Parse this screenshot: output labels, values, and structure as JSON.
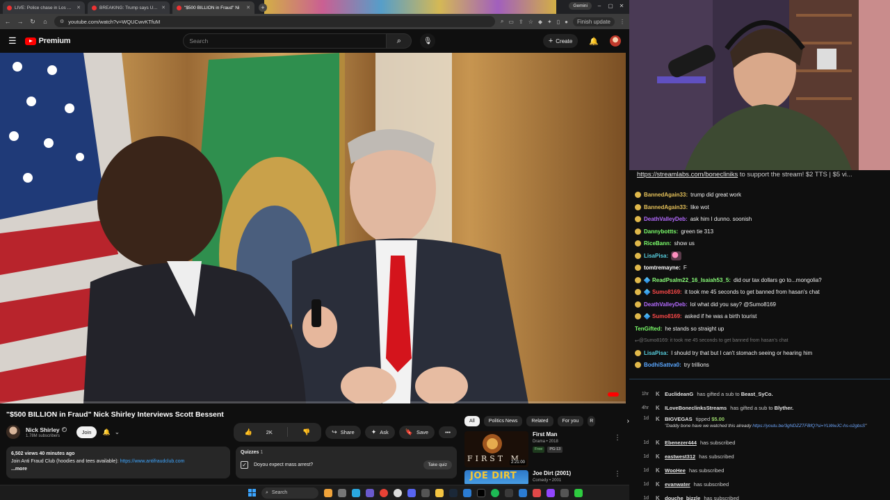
{
  "browser": {
    "tabs": [
      {
        "title": "LIVE: Police chase in Los Angeles",
        "active": false
      },
      {
        "title": "BREAKING: Trump says US wo",
        "active": false
      },
      {
        "title": "\"$500 BILLION in Fraud\" Ni",
        "active": true
      }
    ],
    "gemini_label": "Gemini",
    "url": "youtube.com/watch?v=WQUCwvKTfuM",
    "update_label": "Finish update"
  },
  "youtube": {
    "logo_text": "Premium",
    "search_placeholder": "Search",
    "create_label": "Create",
    "video": {
      "title": "\"$500 BILLION in Fraud\" Nick Shirley Interviews Scott Bessent",
      "channel": "Nick Shirley",
      "subscribers": "1.78M subscribers",
      "join_label": "Join",
      "likes": "2K",
      "share_label": "Share",
      "ask_label": "Ask",
      "save_label": "Save",
      "stats": "6,502 views  40 minutes ago",
      "description_text": "Join Anti Fraud Club (hoodies and tees available): ",
      "description_link": "https://www.antifraudclub.com",
      "more_label": "...more",
      "quiz_title": "Quizzes",
      "quiz_count": "1",
      "quiz_question": "Doyou expect mass arrest?",
      "quiz_button": "Take quiz"
    },
    "chips": [
      "All",
      "Politics News",
      "Related",
      "For you",
      "R"
    ],
    "related": [
      {
        "title": "First Man",
        "meta": "Drama • 2018",
        "badges": [
          "Free",
          "PG-13"
        ],
        "thumb_text": "FIRST M",
        "duration": "2:21:00"
      },
      {
        "title": "Joe Dirt (2001)",
        "meta": "Comedy • 2001",
        "thumb_text": "JOE DIRT"
      }
    ]
  },
  "taskbar": {
    "search_label": "Search"
  },
  "stream": {
    "alert_link": "https://streamlabs.com/bonecliniks",
    "alert_text": " to support the stream! $2 TTS | $5 vi...",
    "chat": [
      {
        "name": "BannedAgain33:",
        "msg": "trump did great work",
        "color": "#e6c25a",
        "icon": "emo"
      },
      {
        "name": "BannedAgain33:",
        "msg": "like wot",
        "color": "#e6c25a",
        "icon": "emo"
      },
      {
        "name": "DeathValleyDeb:",
        "msg": "ask him I dunno. soonish",
        "color": "#b46bff",
        "icon": "emo"
      },
      {
        "name": "Dannybottts:",
        "msg": "green tie 313",
        "color": "#7cff6b",
        "icon": "emo"
      },
      {
        "name": "RiceBann:",
        "msg": "show us",
        "color": "#7cff6b",
        "icon": "emo"
      },
      {
        "name": "LisaPisa:",
        "msg": "",
        "color": "#58d0e0",
        "icon": "emo",
        "sticker": true
      },
      {
        "name": "tomtremayne:",
        "msg": "F",
        "color": "#ffffff",
        "icon": "emo"
      },
      {
        "name": "ReadPsalm22_16_Isaiah53_5:",
        "msg": "did our tax dollars go to...mongolia?",
        "color": "#8aff7a",
        "icon": "gem"
      },
      {
        "name": "Sumo8169:",
        "msg": "it took me 45 seconds to get banned from hasan's chat",
        "color": "#ff4a4a",
        "icon": "gem"
      },
      {
        "name": "DeathValleyDeb:",
        "msg": "lol what did you say? @Sumo8169",
        "color": "#b46bff",
        "icon": "emo"
      },
      {
        "name": "Sumo8169:",
        "msg": "asked if he was a birth tourist",
        "color": "#ff4a4a",
        "icon": "gem"
      },
      {
        "name": "TenGifted:",
        "msg": "he stands so straight up",
        "color": "#7cff6b",
        "icon": "none"
      },
      {
        "name": "",
        "msg": "@Sumo8169: it took me 45 seconds to get banned from hasan's chat",
        "color": "#777777",
        "icon": "reply",
        "dim": true
      },
      {
        "name": "LisaPisa:",
        "msg": "I should try that but I can't stomach seeing or hearing him",
        "color": "#58d0e0",
        "icon": "emo"
      },
      {
        "name": "BodhiSattva0:",
        "msg": "try trillions",
        "color": "#5aa7ff",
        "icon": "emo"
      }
    ],
    "feed": [
      {
        "time": "1hr",
        "user": "EuclideanG",
        "text": " has gifted a sub to ",
        "target": "Beast_SyCo."
      },
      {
        "time": "4hr",
        "user": "ILoveBoneclinksStreams",
        "text": " has gifted a sub to ",
        "target": "Blyther."
      },
      {
        "time": "1d",
        "user": "BIGVEGAS",
        "text": " tipped ",
        "amount": "$5.00",
        "message": "\"Daddy bone have we watched this already ",
        "message_link": "https://youtu.be/3gNDZZTFBfQ?si=YLWwJC-hs-o2gbsS",
        "message_end": "\""
      },
      {
        "time": "1d",
        "user": "Ebenezer444",
        "text": " has subscribed",
        "underline": true
      },
      {
        "time": "1d",
        "user": "eastwest312",
        "text": " has subscribed",
        "underline": true
      },
      {
        "time": "1d",
        "user": "WooHee",
        "text": " has subscribed",
        "underline": true
      },
      {
        "time": "1d",
        "user": "evanwater",
        "text": " has subscribed",
        "underline": true
      },
      {
        "time": "1d",
        "user": "douche_bizzle",
        "text": " has subscribed",
        "underline": true
      }
    ]
  }
}
